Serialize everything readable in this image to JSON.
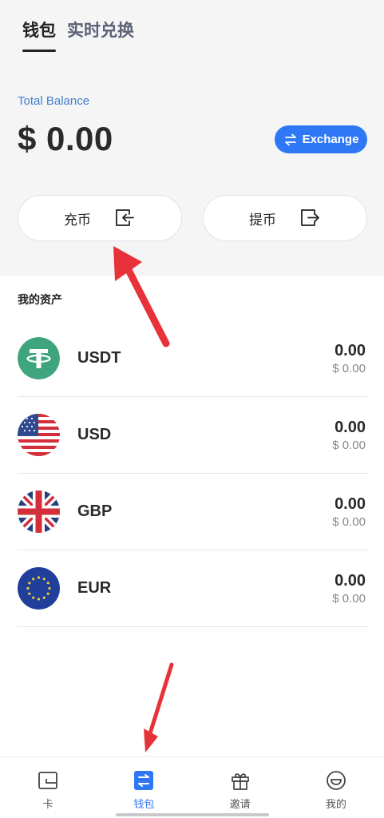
{
  "tabs": [
    {
      "label": "钱包",
      "active": true
    },
    {
      "label": "实时兑换",
      "active": false
    }
  ],
  "balance": {
    "label": "Total Balance",
    "value": "$ 0.00"
  },
  "exchange_button": {
    "label": "Exchange",
    "icon": "swap-arrows-icon"
  },
  "actions": {
    "deposit": {
      "label": "充币",
      "icon": "wallet-in-icon"
    },
    "withdraw": {
      "label": "提币",
      "icon": "wallet-out-icon"
    }
  },
  "assets": {
    "title": "我的资产",
    "items": [
      {
        "name": "USDT",
        "amount": "0.00",
        "fiat": "$ 0.00",
        "icon": "tether-icon"
      },
      {
        "name": "USD",
        "amount": "0.00",
        "fiat": "$ 0.00",
        "icon": "us-flag-icon"
      },
      {
        "name": "GBP",
        "amount": "0.00",
        "fiat": "$ 0.00",
        "icon": "uk-flag-icon"
      },
      {
        "name": "EUR",
        "amount": "0.00",
        "fiat": "$ 0.00",
        "icon": "eu-flag-icon"
      }
    ]
  },
  "bottom_nav": [
    {
      "label": "卡",
      "icon": "card-icon",
      "active": false
    },
    {
      "label": "钱包",
      "icon": "wallet-swap-icon",
      "active": true
    },
    {
      "label": "邀请",
      "icon": "gift-icon",
      "active": false
    },
    {
      "label": "我的",
      "icon": "smile-icon",
      "active": false
    }
  ],
  "colors": {
    "accent": "#2f78f5",
    "balance_label": "#3f7fcf",
    "annotation_arrow": "#e8323a",
    "tether_green": "#3fa57f"
  }
}
